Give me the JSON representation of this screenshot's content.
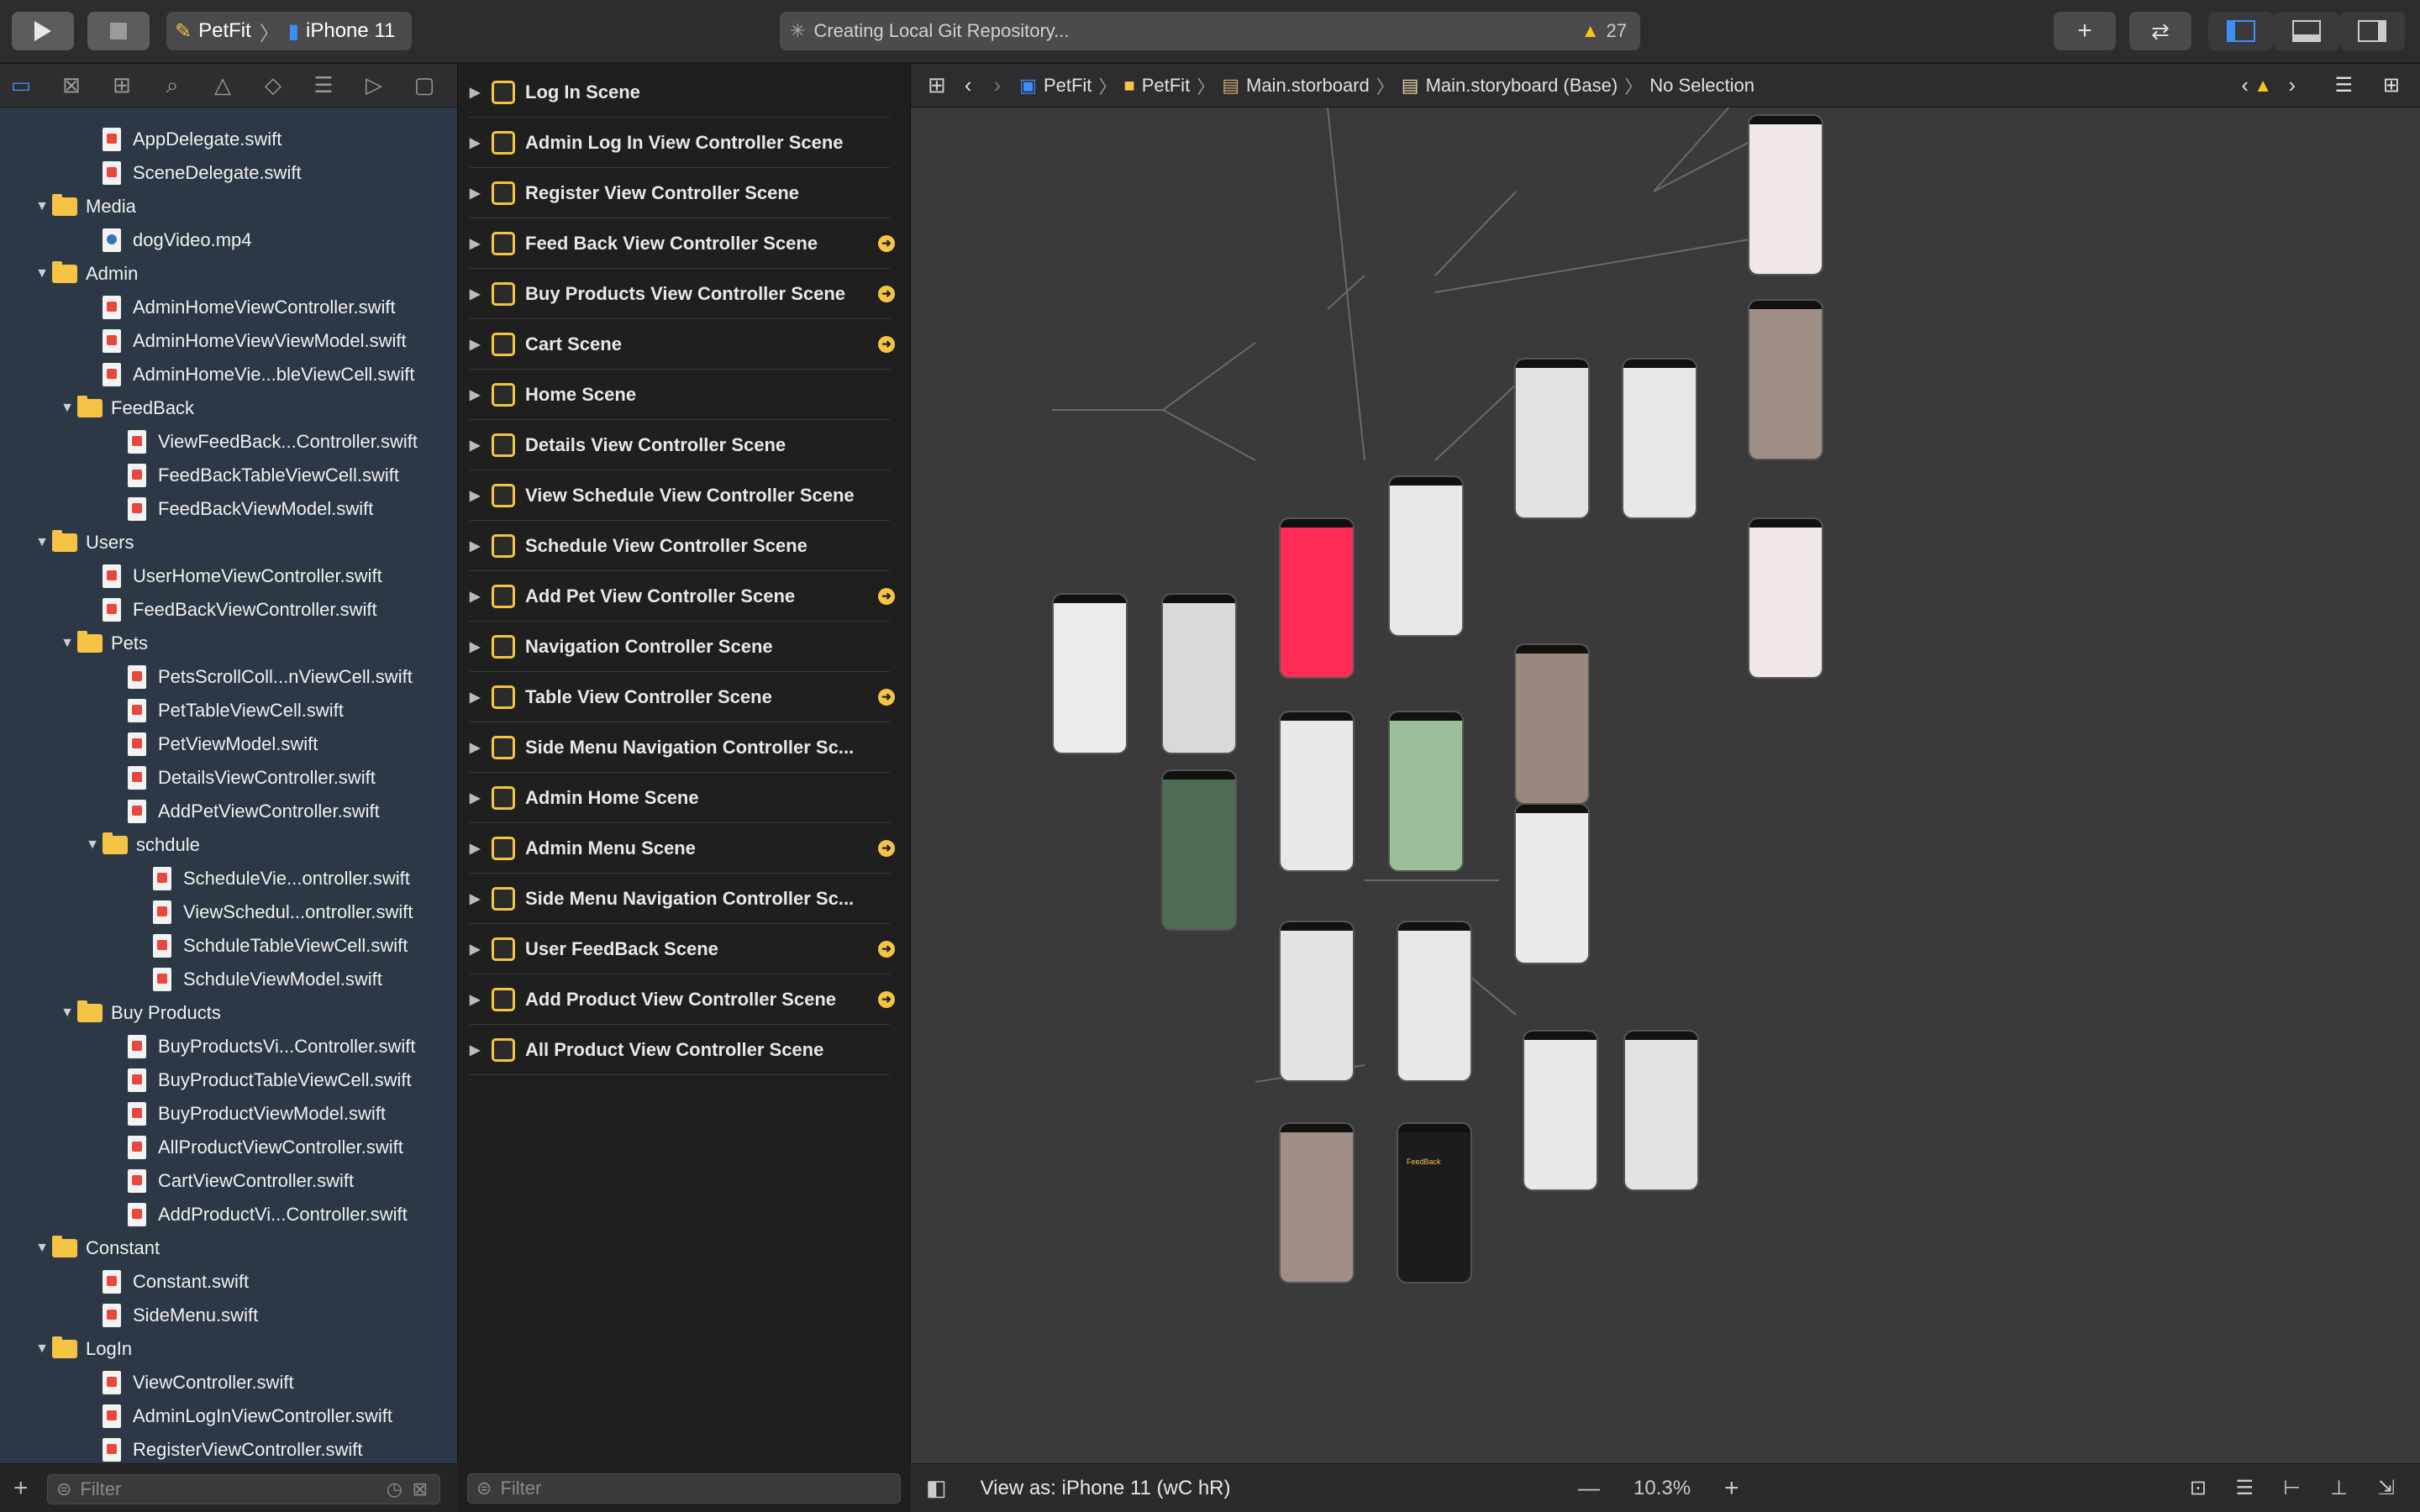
{
  "toolbar": {
    "scheme_project": "PetFit",
    "scheme_device": "iPhone 11",
    "activity_text": "Creating Local Git Repository...",
    "warning_count": "27"
  },
  "navigator": {
    "filter_placeholder": "Filter",
    "items": [
      {
        "label": "AppDelegate.swift",
        "kind": "file",
        "depth": 2
      },
      {
        "label": "SceneDelegate.swift",
        "kind": "file",
        "depth": 2
      },
      {
        "label": "Media",
        "kind": "folder",
        "depth": 1
      },
      {
        "label": "dogVideo.mp4",
        "kind": "video",
        "depth": 2
      },
      {
        "label": "Admin",
        "kind": "folder",
        "depth": 1
      },
      {
        "label": "AdminHomeViewController.swift",
        "kind": "file",
        "depth": 2
      },
      {
        "label": "AdminHomeViewViewModel.swift",
        "kind": "file",
        "depth": 2
      },
      {
        "label": "AdminHomeVie...bleViewCell.swift",
        "kind": "file",
        "depth": 2
      },
      {
        "label": "FeedBack",
        "kind": "folder",
        "depth": 2
      },
      {
        "label": "ViewFeedBack...Controller.swift",
        "kind": "file",
        "depth": 3
      },
      {
        "label": "FeedBackTableViewCell.swift",
        "kind": "file",
        "depth": 3
      },
      {
        "label": "FeedBackViewModel.swift",
        "kind": "file",
        "depth": 3
      },
      {
        "label": "Users",
        "kind": "folder",
        "depth": 1
      },
      {
        "label": "UserHomeViewController.swift",
        "kind": "file",
        "depth": 2
      },
      {
        "label": "FeedBackViewController.swift",
        "kind": "file",
        "depth": 2
      },
      {
        "label": "Pets",
        "kind": "folder",
        "depth": 2
      },
      {
        "label": "PetsScrollColl...nViewCell.swift",
        "kind": "file",
        "depth": 3
      },
      {
        "label": "PetTableViewCell.swift",
        "kind": "file",
        "depth": 3
      },
      {
        "label": "PetViewModel.swift",
        "kind": "file",
        "depth": 3
      },
      {
        "label": "DetailsViewController.swift",
        "kind": "file",
        "depth": 3
      },
      {
        "label": "AddPetViewController.swift",
        "kind": "file",
        "depth": 3
      },
      {
        "label": "schdule",
        "kind": "folder",
        "depth": 3
      },
      {
        "label": "ScheduleVie...ontroller.swift",
        "kind": "file",
        "depth": 4
      },
      {
        "label": "ViewSchedul...ontroller.swift",
        "kind": "file",
        "depth": 4
      },
      {
        "label": "SchduleTableViewCell.swift",
        "kind": "file",
        "depth": 4
      },
      {
        "label": "SchduleViewModel.swift",
        "kind": "file",
        "depth": 4
      },
      {
        "label": "Buy Products",
        "kind": "folder",
        "depth": 2
      },
      {
        "label": "BuyProductsVi...Controller.swift",
        "kind": "file",
        "depth": 3
      },
      {
        "label": "BuyProductTableViewCell.swift",
        "kind": "file",
        "depth": 3
      },
      {
        "label": "BuyProductViewModel.swift",
        "kind": "file",
        "depth": 3
      },
      {
        "label": "AllProductViewController.swift",
        "kind": "file",
        "depth": 3
      },
      {
        "label": "CartViewController.swift",
        "kind": "file",
        "depth": 3
      },
      {
        "label": "AddProductVi...Controller.swift",
        "kind": "file",
        "depth": 3
      },
      {
        "label": "Constant",
        "kind": "folder",
        "depth": 1
      },
      {
        "label": "Constant.swift",
        "kind": "file",
        "depth": 2
      },
      {
        "label": "SideMenu.swift",
        "kind": "file",
        "depth": 2
      },
      {
        "label": "LogIn",
        "kind": "folder",
        "depth": 1
      },
      {
        "label": "ViewController.swift",
        "kind": "file",
        "depth": 2
      },
      {
        "label": "AdminLogInViewController.swift",
        "kind": "file",
        "depth": 2
      },
      {
        "label": "RegisterViewController.swift",
        "kind": "file",
        "depth": 2
      }
    ]
  },
  "outline": {
    "filter_placeholder": "Filter",
    "scenes": [
      {
        "label": "Log In Scene",
        "arrow": false
      },
      {
        "label": "Admin Log In View Controller Scene",
        "arrow": false
      },
      {
        "label": "Register View Controller Scene",
        "arrow": false
      },
      {
        "label": "Feed Back View Controller Scene",
        "arrow": true
      },
      {
        "label": "Buy Products View Controller Scene",
        "arrow": true
      },
      {
        "label": "Cart Scene",
        "arrow": true
      },
      {
        "label": "Home Scene",
        "arrow": false
      },
      {
        "label": "Details View Controller Scene",
        "arrow": false
      },
      {
        "label": "View Schedule View Controller Scene",
        "arrow": false
      },
      {
        "label": "Schedule View Controller Scene",
        "arrow": false
      },
      {
        "label": "Add Pet View Controller Scene",
        "arrow": true
      },
      {
        "label": "Navigation Controller Scene",
        "arrow": false
      },
      {
        "label": "Table View Controller Scene",
        "arrow": true
      },
      {
        "label": "Side Menu Navigation Controller Sc...",
        "arrow": false
      },
      {
        "label": "Admin Home Scene",
        "arrow": false
      },
      {
        "label": "Admin Menu Scene",
        "arrow": true
      },
      {
        "label": "Side Menu Navigation Controller Sc...",
        "arrow": false
      },
      {
        "label": "User FeedBack Scene",
        "arrow": true
      },
      {
        "label": "Add Product View Controller Scene",
        "arrow": true
      },
      {
        "label": "All Product View Controller Scene",
        "arrow": false
      }
    ]
  },
  "jumpbar": {
    "crumbs": [
      "PetFit",
      "PetFit",
      "Main.storboard",
      "Main.storyboard (Base)",
      "No Selection"
    ]
  },
  "bottombar": {
    "view_as": "View as: iPhone 11 (wC hR)",
    "zoom": "10.3%"
  },
  "canvas": {
    "feedback_title": "FeedBack",
    "scene_colors": [
      "#ececec",
      "#d9d9d9",
      "#ff2d55",
      "#e8e8e8",
      "#e3e3e3",
      "#4e6b55",
      "#9bbf9b",
      "#9a877e",
      "#eaeaea",
      "#efe8e6",
      "#a08f86",
      "#1c1c1e"
    ]
  }
}
